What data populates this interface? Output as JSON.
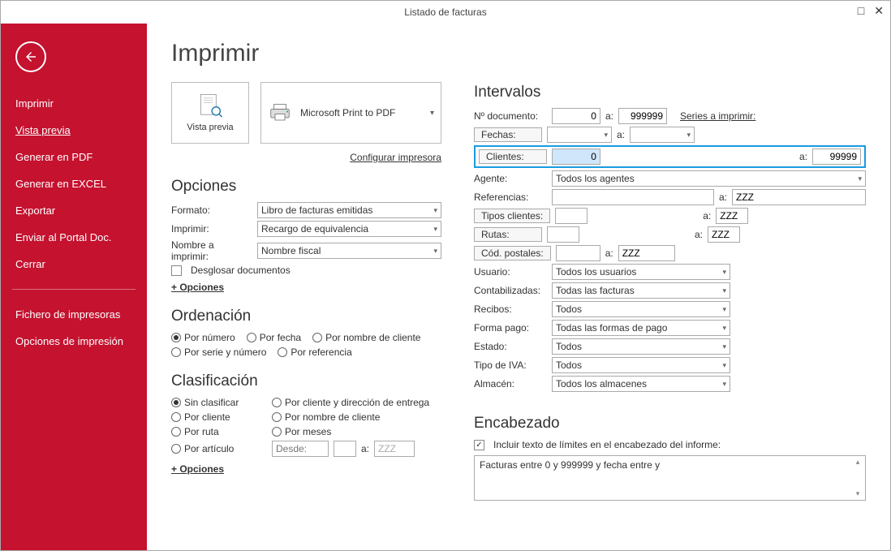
{
  "window": {
    "title": "Listado de facturas"
  },
  "sidebar": {
    "items": [
      "Imprimir",
      "Vista previa",
      "Generar en PDF",
      "Generar en EXCEL",
      "Exportar",
      "Enviar al Portal Doc.",
      "Cerrar"
    ],
    "items2": [
      "Fichero de impresoras",
      "Opciones de impresión"
    ]
  },
  "main": {
    "heading": "Imprimir",
    "preview_label": "Vista previa",
    "printer_name": "Microsoft Print to PDF",
    "config_link": "Configurar impresora",
    "opciones": {
      "title": "Opciones",
      "formato_lbl": "Formato:",
      "formato_val": "Libro de facturas emitidas",
      "imprimir_lbl": "Imprimir:",
      "imprimir_val": "Recargo de equivalencia",
      "nombre_lbl": "Nombre a imprimir:",
      "nombre_val": "Nombre fiscal",
      "desglosar": "Desglosar documentos",
      "mas": "+ Opciones"
    },
    "ordenacion": {
      "title": "Ordenación",
      "r1": "Por número",
      "r2": "Por fecha",
      "r3": "Por nombre de cliente",
      "r4": "Por serie y número",
      "r5": "Por referencia"
    },
    "clasif": {
      "title": "Clasificación",
      "r1": "Sin clasificar",
      "r2": "Por cliente y dirección de entrega",
      "r3": "Por cliente",
      "r4": "Por nombre de cliente",
      "r5": "Por ruta",
      "r6": "Por meses",
      "r7": "Por artículo",
      "desde": "Desde:",
      "a": "a:",
      "a_val": "ZZZ",
      "mas": "+ Opciones"
    }
  },
  "intervalos": {
    "title": "Intervalos",
    "ndoc_lbl": "Nº documento:",
    "ndoc_from": "0",
    "a": "a:",
    "ndoc_to": "999999",
    "series": "Series a imprimir:",
    "fechas_btn": "Fechas:",
    "clientes_btn": "Clientes:",
    "clientes_from": "0",
    "clientes_to": "99999",
    "agente_lbl": "Agente:",
    "agente_val": "Todos los agentes",
    "ref_lbl": "Referencias:",
    "ref_to": "ZZZ",
    "tipos_btn": "Tipos clientes:",
    "tipos_to": "ZZZ",
    "rutas_btn": "Rutas:",
    "rutas_to": "ZZZ",
    "cod_btn": "Cód. postales:",
    "cod_to": "ZZZ",
    "usuario_lbl": "Usuario:",
    "usuario_val": "Todos los usuarios",
    "contab_lbl": "Contabilizadas:",
    "contab_val": "Todas las facturas",
    "recibos_lbl": "Recibos:",
    "recibos_val": "Todos",
    "forma_lbl": "Forma pago:",
    "forma_val": "Todas las formas de pago",
    "estado_lbl": "Estado:",
    "estado_val": "Todos",
    "tipoiva_lbl": "Tipo de IVA:",
    "tipoiva_val": "Todos",
    "almacen_lbl": "Almacén:",
    "almacen_val": "Todos los almacenes"
  },
  "encabezado": {
    "title": "Encabezado",
    "chk_lbl": "Incluir texto de límites en el encabezado del informe:",
    "text": "Facturas entre 0 y 999999 y fecha entre  y"
  }
}
